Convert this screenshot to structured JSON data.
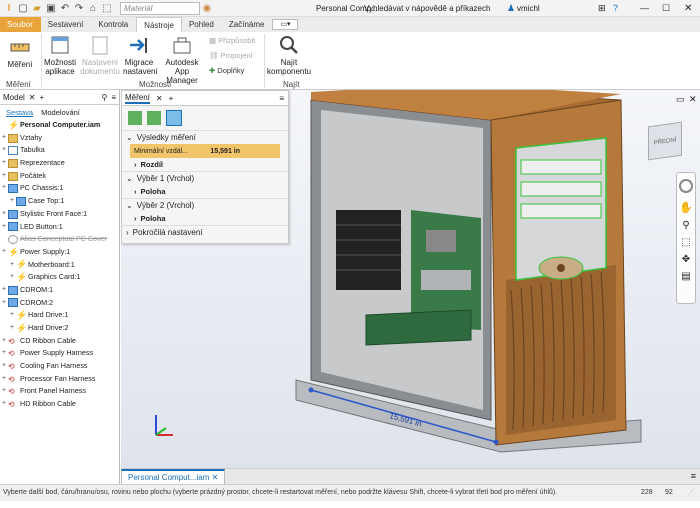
{
  "titlebar": {
    "material_placeholder": "Materiál",
    "doc_title": "Personal Comp...",
    "search_label": "Vyhledávat v nápovědě a příkazech",
    "user": "vmichl",
    "help_icon": "?"
  },
  "tabs": [
    "Soubor",
    "Sestavení",
    "Kontrola",
    "Nástroje",
    "Pohled",
    "Začínáme"
  ],
  "ribbon": {
    "measure": "Měření",
    "options": "Možnosti aplikace",
    "doc_settings": "Nastavení dokumentu",
    "migrate": "Migrace nastavení",
    "app_manager": "Autodesk App Manager",
    "customize": "Přizpůsobit",
    "links": "Propojení",
    "addins": "Doplňky",
    "find": "Najít komponentu",
    "group_measure": "Měření",
    "group_options": "Možnosti",
    "group_find": "Najít"
  },
  "left_panel": {
    "tab_model": "Model",
    "tab_assembly": "Sestava",
    "tab_modeling": "Modelování",
    "tree": [
      {
        "label": "Personal Computer.iam",
        "icon": "assembly",
        "bold": true,
        "indent": 0,
        "exp": ""
      },
      {
        "label": "Vztahy",
        "icon": "folder",
        "indent": 0,
        "exp": "+"
      },
      {
        "label": "Tabulka",
        "icon": "table",
        "indent": 0,
        "exp": "+"
      },
      {
        "label": "Reprezentace",
        "icon": "folder",
        "indent": 0,
        "exp": "+"
      },
      {
        "label": "Počátek",
        "icon": "folder",
        "indent": 0,
        "exp": "+"
      },
      {
        "label": "PC Chassis:1",
        "icon": "part",
        "indent": 0,
        "exp": "+"
      },
      {
        "label": "Case Top:1",
        "icon": "part",
        "indent": 1,
        "exp": "+"
      },
      {
        "label": "Stylistic Front Face:1",
        "icon": "part",
        "indent": 0,
        "exp": "+"
      },
      {
        "label": "LED Button:1",
        "icon": "part",
        "indent": 0,
        "exp": "+"
      },
      {
        "label": "Alias Conceptual PC Cover",
        "icon": "suppressed",
        "indent": 0,
        "exp": "",
        "strike": true
      },
      {
        "label": "Power Supply:1",
        "icon": "assembly",
        "indent": 0,
        "exp": "+"
      },
      {
        "label": "Motherboard:1",
        "icon": "assembly",
        "indent": 1,
        "exp": "+"
      },
      {
        "label": "Graphics Card:1",
        "icon": "assembly",
        "indent": 1,
        "exp": "+"
      },
      {
        "label": "CDROM:1",
        "icon": "part",
        "indent": 0,
        "exp": "+"
      },
      {
        "label": "CDROM:2",
        "icon": "part",
        "indent": 0,
        "exp": "+"
      },
      {
        "label": "Hard Drive:1",
        "icon": "assembly",
        "indent": 1,
        "exp": "+"
      },
      {
        "label": "Hard Drive:2",
        "icon": "assembly",
        "indent": 1,
        "exp": "+"
      },
      {
        "label": "CD Ribbon Cable",
        "icon": "harness",
        "indent": 0,
        "exp": "+"
      },
      {
        "label": "Power Supply Harness",
        "icon": "harness",
        "indent": 0,
        "exp": "+"
      },
      {
        "label": "Cooling Fan Harness",
        "icon": "harness",
        "indent": 0,
        "exp": "+"
      },
      {
        "label": "Processor Fan Harness",
        "icon": "harness",
        "indent": 0,
        "exp": "+"
      },
      {
        "label": "Front Panel Harness",
        "icon": "harness",
        "indent": 0,
        "exp": "+"
      },
      {
        "label": "HD Ribbon Cable",
        "icon": "harness",
        "indent": 0,
        "exp": "+"
      }
    ]
  },
  "measure_panel": {
    "tab": "Měření",
    "results": "Výsledky měření",
    "min_label": "Minimální vzdál...",
    "min_value": "15,591 in",
    "difference": "Rozdíl",
    "sel1": "Výběr 1 (Vrchol)",
    "pos1": "Poloha",
    "sel2": "Výběr 2 (Vrchol)",
    "pos2": "Poloha",
    "advanced": "Pokročilá nastavení"
  },
  "viewport": {
    "dimension": "15,591 in",
    "viewcube_label": "PŘEDNÍ"
  },
  "doc_tab": "Personal Comput...iam",
  "status": {
    "text": "Vyberte další bod, čáru/hranu/osu, rovinu nebo plochu (vyberte prázdný prostor, chcete-li restartovat měření, nebo podržte klávesu Shift, chcete-li vybrat třetí bod pro měření úhlů).",
    "n1": "228",
    "n2": "92"
  },
  "colors": {
    "accent": "#1a6fb8",
    "file_tab": "#e8a33a",
    "highlight": "#f2c56a",
    "case_wood": "#b5793c"
  }
}
